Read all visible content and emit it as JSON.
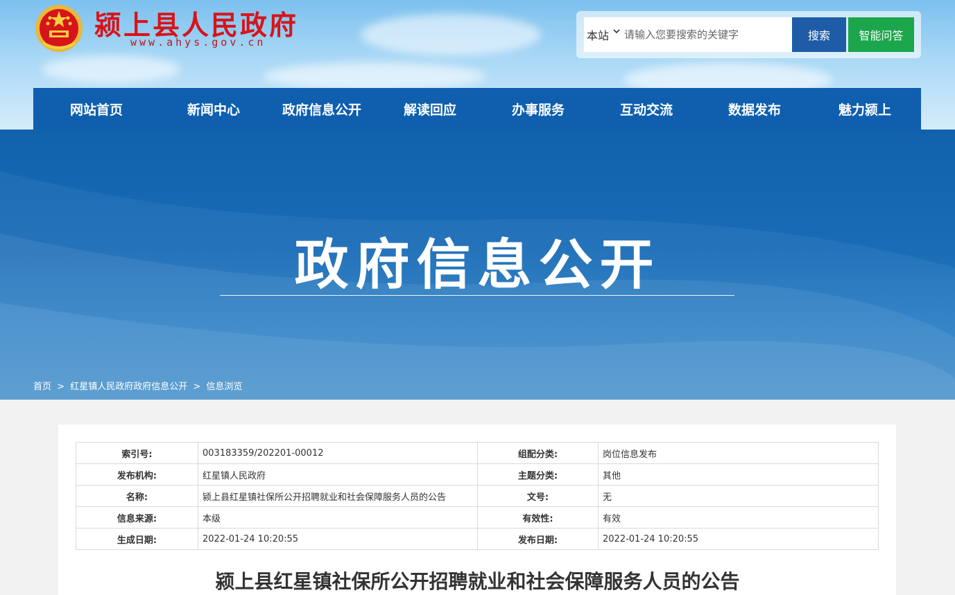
{
  "header": {
    "site_title": "颍上县人民政府",
    "site_url": "www.ahys.gov.cn",
    "search": {
      "scope": "本站",
      "placeholder": "请输入您要搜索的关键字",
      "search_label": "搜索",
      "ai_label": "智能问答"
    }
  },
  "nav": {
    "items": [
      "网站首页",
      "新闻中心",
      "政府信息公开",
      "解读回应",
      "办事服务",
      "互动交流",
      "数据发布",
      "魅力颍上"
    ]
  },
  "banner": {
    "title": "政府信息公开"
  },
  "breadcrumb": {
    "items": [
      "首页",
      "红星镇人民政府政府信息公开",
      "信息浏览"
    ],
    "sep": ">"
  },
  "meta": {
    "rows": [
      [
        "索引号:",
        "003183359/202201-00012",
        "组配分类:",
        "岗位信息发布"
      ],
      [
        "发布机构:",
        "红星镇人民政府",
        "主题分类:",
        "其他"
      ],
      [
        "名称:",
        "颍上县红星镇社保所公开招聘就业和社会保障服务人员的公告",
        "文号:",
        "无"
      ],
      [
        "信息来源:",
        "本级",
        "有效性:",
        "有效"
      ],
      [
        "生成日期:",
        "2022-01-24 10:20:55",
        "发布日期:",
        "2022-01-24 10:20:55"
      ]
    ]
  },
  "article": {
    "title": "颍上县红星镇社保所公开招聘就业和社会保障服务人员的公告"
  },
  "colors": {
    "nav_bg": "#0f5fae",
    "title_red": "#d7141a",
    "search_btn": "#1e5ca8",
    "ai_btn": "#1ca64b"
  }
}
